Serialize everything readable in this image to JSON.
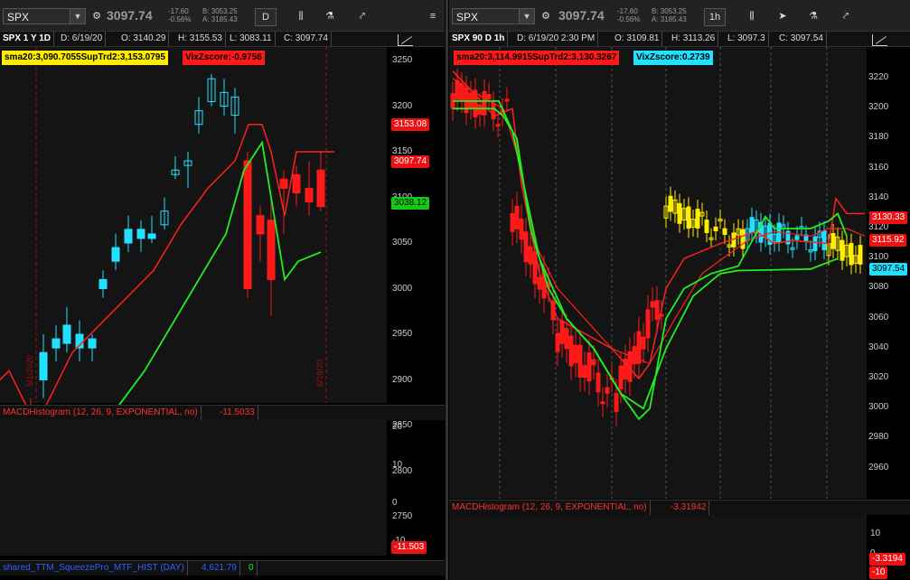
{
  "left": {
    "toolbar": {
      "symbol": "SPX",
      "price": "3097.74",
      "change": "-17.60",
      "change_pct": "-0.56%",
      "bid": "B: 3053.25",
      "ask": "A: 3185.43",
      "interval": "D"
    },
    "info": {
      "symbol_label": "SPX 1 Y 1D",
      "date": "D: 6/19/20",
      "open": "O: 3140.29",
      "high": "H: 3155.53",
      "low": "L: 3083.11",
      "close": "C: 3097.74"
    },
    "study_label_1": "sma20:3,090.7055SupTrd2:3,153.0795",
    "study_label_2": "VixZscore:-0.9756",
    "price_ticks": [
      "3250",
      "3200",
      "3150",
      "3100",
      "3050",
      "3000",
      "2950",
      "2900",
      "2850",
      "2800",
      "2750"
    ],
    "badges": {
      "sma": "3153.08",
      "last": "3097.74",
      "trend": "3038.12"
    },
    "date_marks": [
      "5/1/2020",
      "6/19/20"
    ],
    "macd_label": "MACDHistogram (12, 26, 9, EXPONENTIAL, no)",
    "macd_value": "-11.5033",
    "macd_ticks": [
      "20",
      "10",
      "0",
      "-10"
    ],
    "macd_badge": "-11.503",
    "squeeze_label": "shared_TTM_SqueezePro_MTF_HIST (DAY)",
    "squeeze_value": "4,621.79",
    "squeeze_zero": "0"
  },
  "right": {
    "toolbar": {
      "symbol": "SPX",
      "price": "3097.74",
      "change": "-17.60",
      "change_pct": "-0.56%",
      "bid": "B: 3053.25",
      "ask": "A: 3185.43",
      "interval": "1h"
    },
    "info": {
      "symbol_label": "SPX 90 D 1h",
      "date": "D: 6/19/20 2:30 PM",
      "open": "O: 3109.81",
      "high": "H: 3113.26",
      "low": "L: 3097.3",
      "close": "C: 3097.54"
    },
    "study_label_1": "sma20:3,114.9915SupTrd2:3,130.3267",
    "study_label_2": "VixZscore:0.2739",
    "price_ticks": [
      "3220",
      "3200",
      "3180",
      "3160",
      "3140",
      "3120",
      "3100",
      "3080",
      "3060",
      "3040",
      "3020",
      "3000",
      "2980",
      "2960"
    ],
    "badges": {
      "sma": "3130.33",
      "last": "3115.92",
      "close": "3097.54"
    },
    "macd_label": "MACDHistogram (12, 26, 9, EXPONENTIAL, no)",
    "macd_value": "-3.31942",
    "macd_ticks": [
      "10",
      "0",
      "-10"
    ],
    "macd_badge": "-3.3194",
    "macd_badge2": "-10"
  },
  "colors": {
    "up": "#22e0ff",
    "down": "#ff1a1a",
    "yellow": "#ffee00",
    "green": "#22ee22",
    "darkgreen": "#0a7a0a",
    "darkred": "#8a0a0a",
    "red_line": "#ff2020"
  }
}
